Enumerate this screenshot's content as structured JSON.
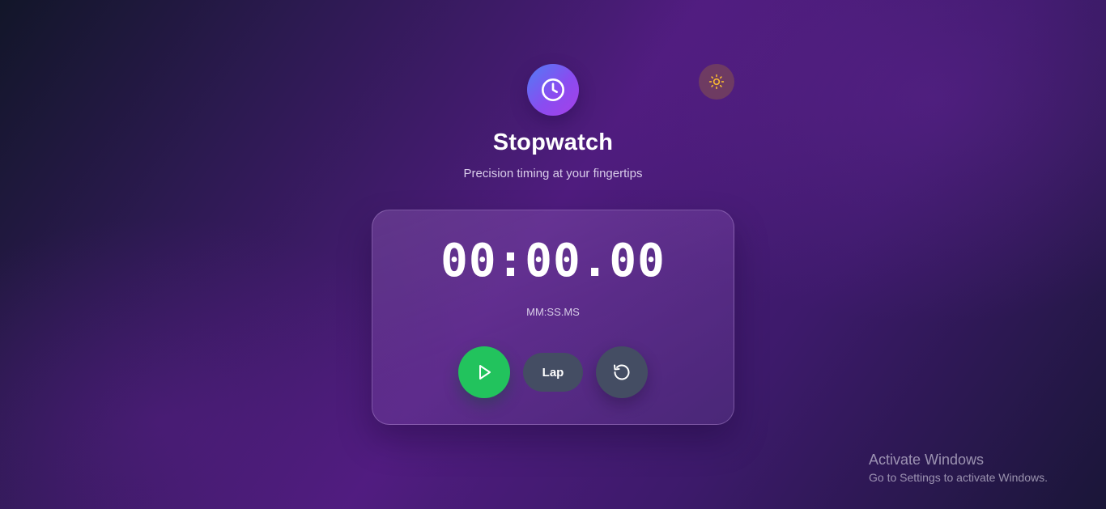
{
  "app": {
    "title": "Stopwatch",
    "subtitle": "Precision timing at your fingertips",
    "icon": "clock-icon"
  },
  "theme_toggle": {
    "icon": "sun-icon",
    "icon_color": "#f5b731"
  },
  "timer": {
    "display": "00:00.00",
    "format_label": "MM:SS.MS"
  },
  "controls": {
    "start": {
      "icon": "play-icon",
      "color": "#22c35d"
    },
    "lap_label": "Lap",
    "reset": {
      "icon": "reset-icon"
    }
  },
  "watermark": {
    "title": "Activate Windows",
    "subtitle": "Go to Settings to activate Windows."
  },
  "colors": {
    "accent_gradient_start": "#4f7df5",
    "accent_gradient_end": "#a640e8",
    "secondary_button": "#444d63"
  }
}
